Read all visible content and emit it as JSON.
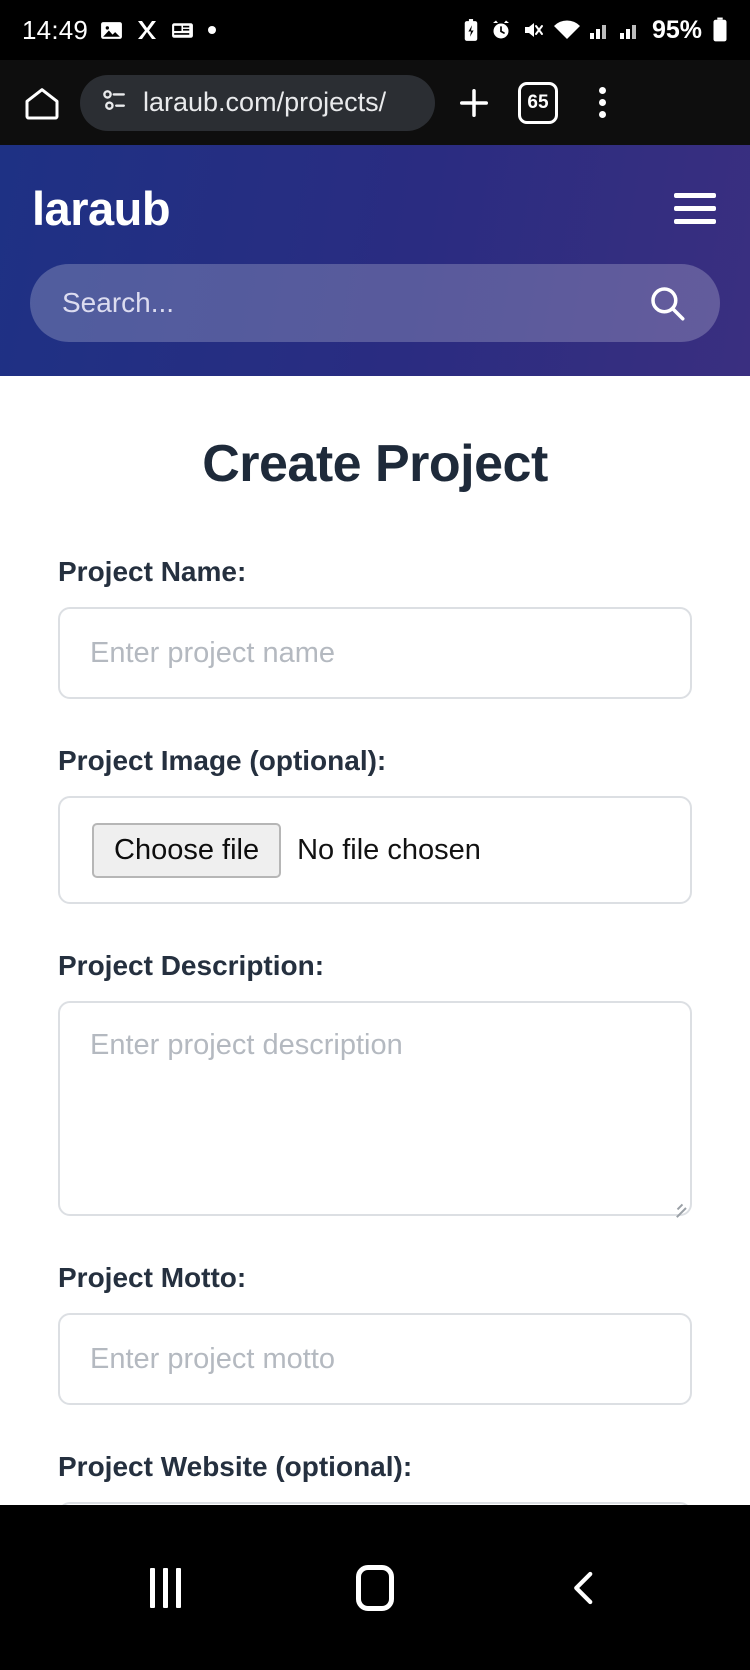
{
  "status_bar": {
    "time": "14:49",
    "left_icons": [
      "photo-icon",
      "x-app-icon",
      "news-icon",
      "dot-icon"
    ],
    "right_icons": [
      "battery-saver-icon",
      "alarm-icon",
      "mute-icon",
      "wifi-icon",
      "signal-1-icon",
      "signal-2-icon"
    ],
    "battery_percent": "95%"
  },
  "browser": {
    "home_label": "home-icon",
    "site_info_icon": "page-info-icon",
    "url": "laraub.com/projects/",
    "new_tab_label": "+",
    "tab_count": "65",
    "menu_label": "more-options"
  },
  "site_header": {
    "brand": "laraub",
    "menu_label": "menu",
    "gradient_start": "#1e3184",
    "gradient_end": "#3a2f80",
    "search": {
      "placeholder": "Search...",
      "value": "",
      "icon": "search-icon"
    }
  },
  "main": {
    "title": "Create Project",
    "fields": [
      {
        "label": "Project Name:",
        "type": "text",
        "placeholder": "Enter project name",
        "value": ""
      },
      {
        "label": "Project Image (optional):",
        "type": "file",
        "button_label": "Choose file",
        "status_text": "No file chosen"
      },
      {
        "label": "Project Description:",
        "type": "textarea",
        "placeholder": "Enter project description",
        "value": ""
      },
      {
        "label": "Project Motto:",
        "type": "text",
        "placeholder": "Enter project motto",
        "value": ""
      },
      {
        "label": "Project Website (optional):",
        "type": "text",
        "placeholder": "",
        "value": ""
      }
    ]
  },
  "nav_bar": {
    "recents_label": "recents-icon",
    "home_label": "home-icon",
    "back_label": "back-icon"
  }
}
